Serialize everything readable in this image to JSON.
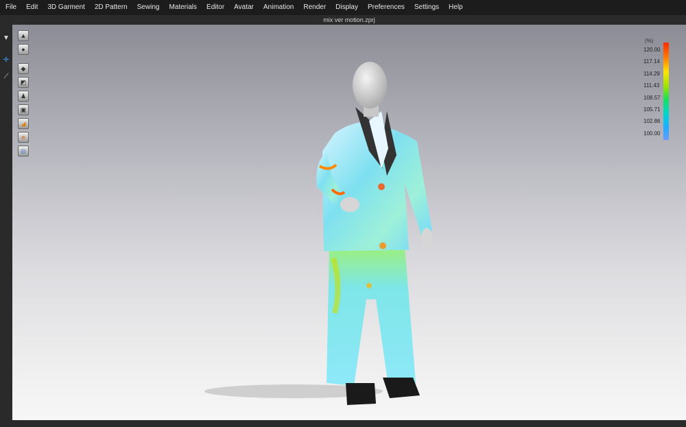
{
  "menu": [
    "File",
    "Edit",
    "3D Garment",
    "2D Pattern",
    "Sewing",
    "Materials",
    "Editor",
    "Avatar",
    "Animation",
    "Render",
    "Display",
    "Preferences",
    "Settings",
    "Help"
  ],
  "window_title": "mix ver motion.zprj",
  "legend": {
    "unit": "(%)",
    "labels": [
      "120.00",
      "117.14",
      "114.29",
      "111.43",
      "108.57",
      "105.71",
      "102.86",
      "100.00"
    ]
  },
  "toolbar_icons": [
    "garment-view-icon",
    "avatar-view-icon",
    "show-garment-icon",
    "show-pattern-icon",
    "show-avatar-icon",
    "texture-icon",
    "strain-map-icon",
    "avatar-skin-icon",
    "mesh-icon"
  ]
}
